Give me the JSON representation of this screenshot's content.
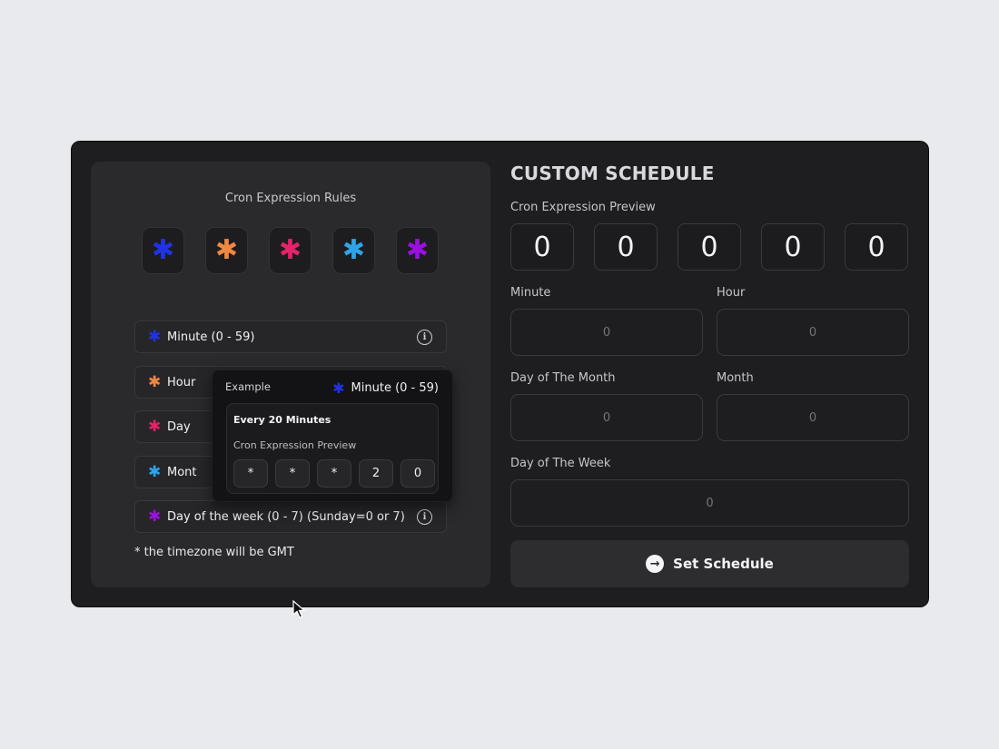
{
  "left_panel": {
    "title": "Cron Expression Rules",
    "stars": [
      {
        "glyph": "✱",
        "color": "#1f33e6"
      },
      {
        "glyph": "✱",
        "color": "#f08840"
      },
      {
        "glyph": "✱",
        "color": "#e5226a"
      },
      {
        "glyph": "✱",
        "color": "#2ea4e8"
      },
      {
        "glyph": "✱",
        "color": "#9b10e0"
      }
    ],
    "rules": [
      {
        "label": "Minute (0 - 59)",
        "color": "#1f33e6",
        "glyph": "✱"
      },
      {
        "label": "Hour",
        "color": "#f08840",
        "glyph": "✱"
      },
      {
        "label": "Day",
        "color": "#e5226a",
        "glyph": "✱"
      },
      {
        "label": "Mont",
        "color": "#2ea4e8",
        "glyph": "✱"
      },
      {
        "label": "Day of the week (0 - 7) (Sunday=0 or 7)",
        "color": "#9b10e0",
        "glyph": "✱"
      }
    ],
    "info_glyph": "i",
    "timezone_note": "* the timezone will be GMT"
  },
  "tooltip": {
    "example_label": "Example",
    "field_label": "Minute (0 - 59)",
    "field_glyph": "✱",
    "card_title": "Every 20 Minutes",
    "card_subtitle": "Cron Expression Preview",
    "cells": [
      "*",
      "*",
      "*",
      "2",
      "0"
    ]
  },
  "right_panel": {
    "title": "CUSTOM SCHEDULE",
    "preview_label": "Cron Expression Preview",
    "preview_digits": [
      "0",
      "0",
      "0",
      "0",
      "0"
    ],
    "fields": {
      "minute": {
        "label": "Minute",
        "placeholder": "0"
      },
      "hour": {
        "label": "Hour",
        "placeholder": "0"
      },
      "day_of_month": {
        "label": "Day of The Month",
        "placeholder": "0"
      },
      "month": {
        "label": "Month",
        "placeholder": "0"
      },
      "day_of_week": {
        "label": "Day of The Week",
        "placeholder": "0"
      }
    },
    "submit": {
      "label": "Set Schedule",
      "icon_glyph": "→"
    }
  }
}
